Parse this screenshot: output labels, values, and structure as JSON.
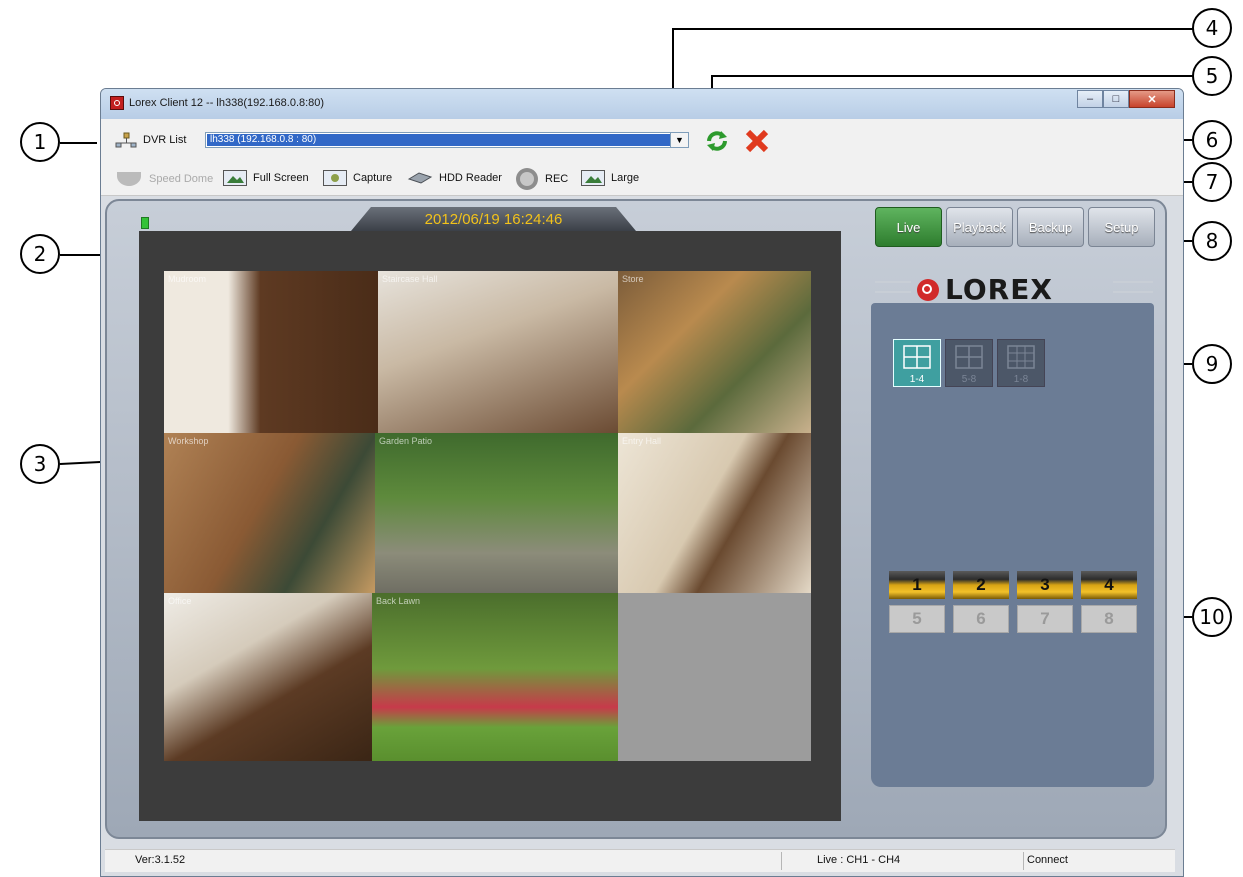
{
  "window": {
    "title": "Lorex Client 12 -- lh338(192.168.0.8:80)"
  },
  "toolbar": {
    "dvr_list_label": "DVR List",
    "dvr_selected": "lh338 (192.168.0.8 : 80)",
    "buttons": [
      "Speed Dome",
      "Full Screen",
      "Capture",
      "HDD Reader",
      "REC",
      "Large"
    ],
    "refresh_icon": "refresh-icon",
    "delete_icon": "delete-x-icon"
  },
  "viewer": {
    "datetime": "2012/06/19 16:24:46",
    "cameras": [
      {
        "name": "Mudroom"
      },
      {
        "name": "Staircase Hall"
      },
      {
        "name": "Store"
      },
      {
        "name": "Workshop"
      },
      {
        "name": "Garden Patio"
      },
      {
        "name": "Entry Hall"
      },
      {
        "name": "Office"
      },
      {
        "name": "Back Lawn"
      }
    ]
  },
  "modes": [
    {
      "label": "Live",
      "active": true
    },
    {
      "label": "Playback",
      "active": false
    },
    {
      "label": "Backup",
      "active": false
    },
    {
      "label": "Setup",
      "active": false
    }
  ],
  "brand": {
    "logo": "LOREX"
  },
  "layouts": [
    {
      "caption": "1-4",
      "active": true
    },
    {
      "caption": "5-8",
      "active": false
    },
    {
      "caption": "1-8",
      "active": false
    }
  ],
  "channels": [
    {
      "label": "1",
      "active": true
    },
    {
      "label": "2",
      "active": true
    },
    {
      "label": "3",
      "active": true
    },
    {
      "label": "4",
      "active": true
    },
    {
      "label": "5",
      "active": false
    },
    {
      "label": "6",
      "active": false
    },
    {
      "label": "7",
      "active": false
    },
    {
      "label": "8",
      "active": false
    }
  ],
  "status": {
    "version": "Ver:3.1.52",
    "live": "Live : CH1 - CH4",
    "connection": "Connect"
  },
  "callouts": [
    "1",
    "2",
    "3",
    "4",
    "5",
    "6",
    "7",
    "8",
    "9",
    "10"
  ],
  "colors": {
    "accent_live": "#2e7d2e",
    "datetime": "#f2c21b",
    "channel_active": "#f3c12a",
    "logo_red": "#d12a2a",
    "panel_blue": "#6b7c95"
  }
}
